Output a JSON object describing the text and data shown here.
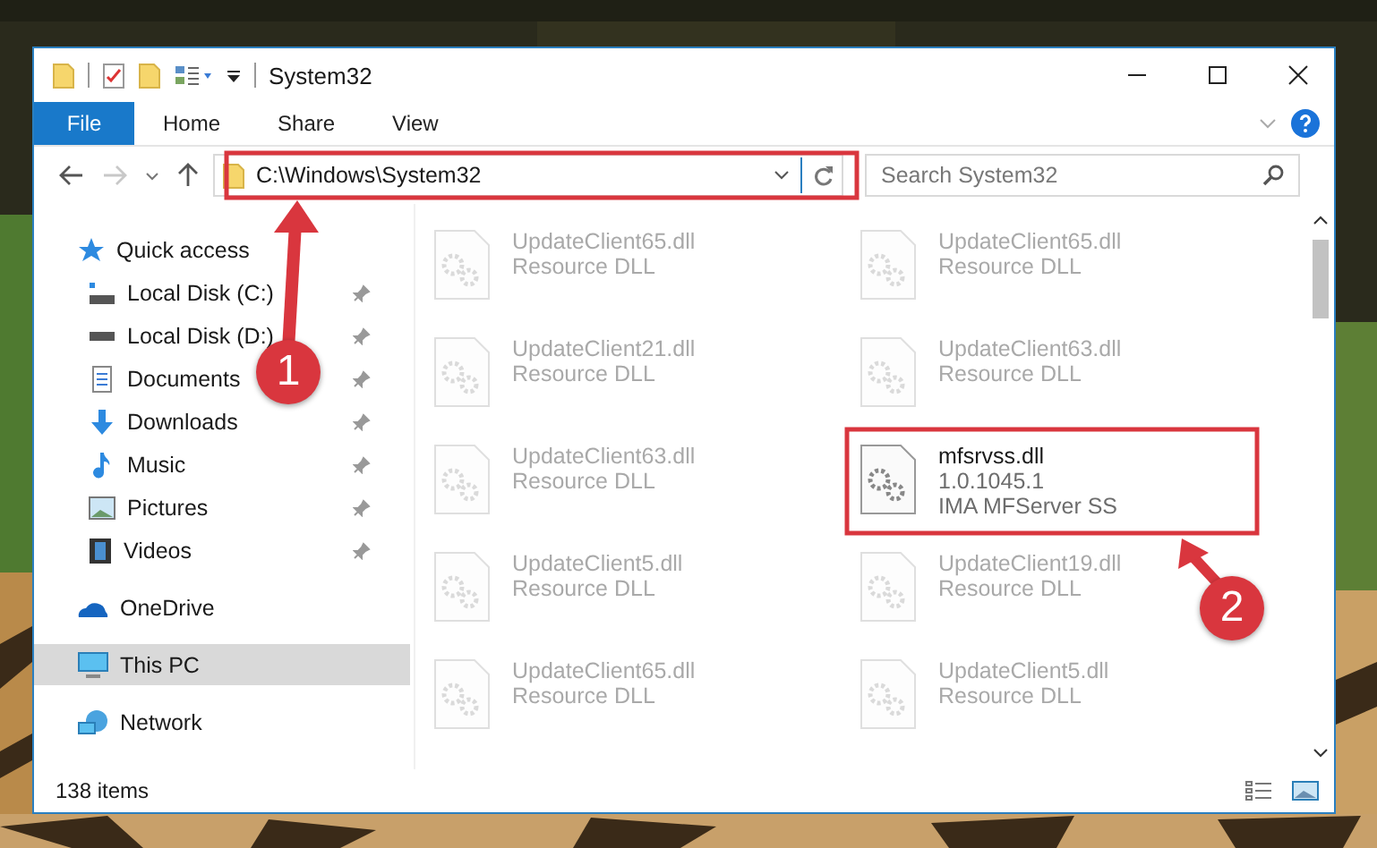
{
  "window": {
    "title": "System32"
  },
  "ribbon_tabs": [
    {
      "label": "File",
      "kind": "file"
    },
    {
      "label": "Home",
      "kind": "tab"
    },
    {
      "label": "Share",
      "kind": "tab"
    },
    {
      "label": "View",
      "kind": "tab"
    }
  ],
  "address": {
    "path": "C:\\Windows\\System32"
  },
  "search": {
    "placeholder": "Search System32"
  },
  "navigation": [
    {
      "label": "Quick access",
      "kind": "star",
      "selected": false,
      "children": [
        {
          "label": "Local Disk (C:)",
          "kind": "system-drive",
          "selected": false
        },
        {
          "label": "Local Disk (D:)",
          "kind": "drive",
          "selected": false
        },
        {
          "label": "Documents",
          "kind": "documents",
          "selected": false
        },
        {
          "label": "Downloads",
          "kind": "downloads",
          "selected": false
        },
        {
          "label": "Music",
          "kind": "music",
          "selected": false
        },
        {
          "label": "Pictures",
          "kind": "pictures",
          "selected": false
        },
        {
          "label": "Videos",
          "kind": "videos",
          "selected": false
        }
      ]
    },
    {
      "label": "OneDrive",
      "kind": "cloud",
      "selected": false
    },
    {
      "label": "This PC",
      "kind": "computer",
      "selected": true
    },
    {
      "label": "Network",
      "kind": "network",
      "selected": false
    }
  ],
  "files": [
    {
      "name": "UpdateClient65.dll",
      "lines": [
        "Resource DLL"
      ],
      "blurred": true
    },
    {
      "name": "UpdateClient65.dll",
      "lines": [
        "Resource DLL"
      ],
      "blurred": true
    },
    {
      "name": "UpdateClient21.dll",
      "lines": [
        "Resource DLL"
      ],
      "blurred": true
    },
    {
      "name": "UpdateClient63.dll",
      "lines": [
        "Resource DLL"
      ],
      "blurred": true
    },
    {
      "name": "UpdateClient63.dll",
      "lines": [
        "Resource DLL"
      ],
      "blurred": true
    },
    {
      "name": "mfsrvss.dll",
      "lines": [
        "1.0.1045.1",
        "IMA MFServer SS"
      ],
      "blurred": false
    },
    {
      "name": "UpdateClient5.dll",
      "lines": [
        "Resource DLL"
      ],
      "blurred": true
    },
    {
      "name": "UpdateClient19.dll",
      "lines": [
        "Resource DLL"
      ],
      "blurred": true
    },
    {
      "name": "UpdateClient65.dll",
      "lines": [
        "Resource DLL"
      ],
      "blurred": true
    },
    {
      "name": "UpdateClient5.dll",
      "lines": [
        "Resource DLL"
      ],
      "blurred": true
    }
  ],
  "status_bar": {
    "count": "138 items"
  },
  "callouts": [
    {
      "number": "1"
    },
    {
      "number": "2"
    }
  ]
}
